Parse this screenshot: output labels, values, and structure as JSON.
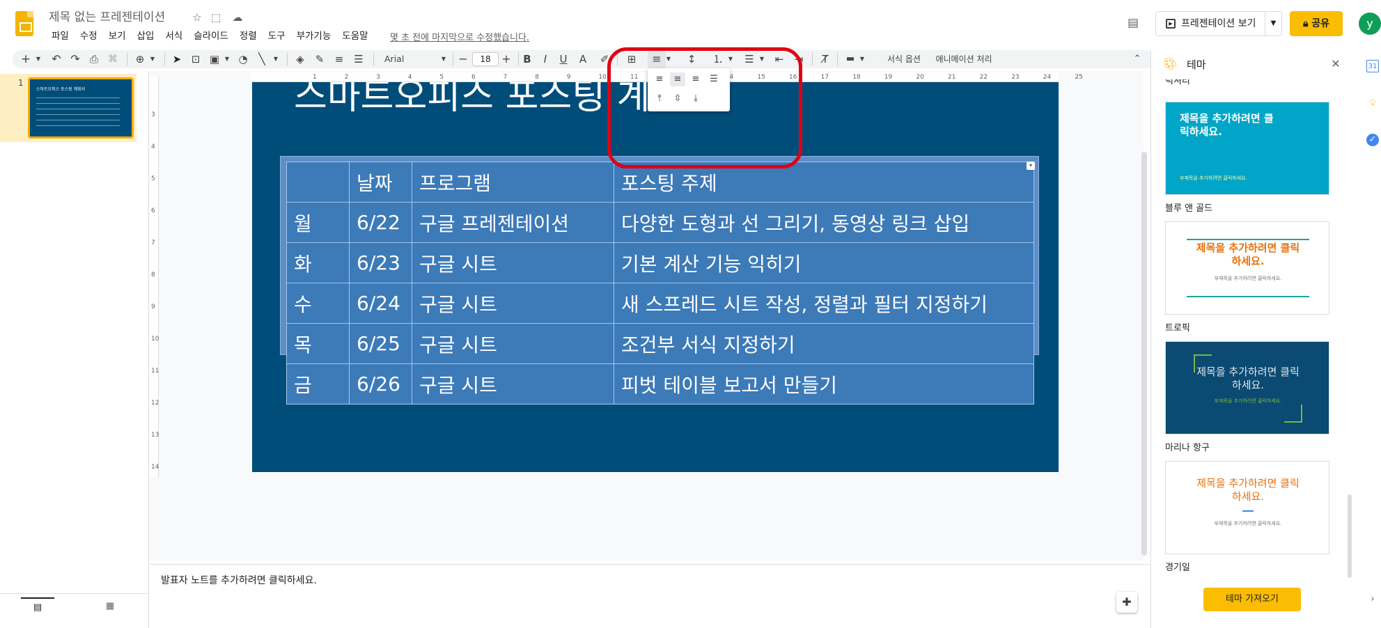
{
  "header": {
    "title": "제목 없는 프레젠테이션",
    "menu": [
      "파일",
      "수정",
      "보기",
      "삽입",
      "서식",
      "슬라이드",
      "정렬",
      "도구",
      "부가기능",
      "도움말"
    ],
    "last_edit": "몇 초 전에 마지막으로 수정했습니다.",
    "present_label": "프레젠테이션 보기",
    "share_label": "공유",
    "avatar_letter": "y"
  },
  "toolbar": {
    "font_name": "Arial",
    "font_size": "18",
    "format_options": "서식 옵션",
    "animation": "애니메이션 처리"
  },
  "filmstrip": {
    "slide_number": "1",
    "thumb_title": "스마트오피스 포스팅 계획서"
  },
  "slide": {
    "title": "스마트오피스 포스팅 계",
    "table": {
      "header": [
        "",
        "날짜",
        "프로그램",
        "포스팅 주제"
      ],
      "rows": [
        [
          "월",
          "6/22",
          "구글 프레젠테이션",
          "다양한 도형과 선 그리기, 동영상 링크 삽입"
        ],
        [
          "화",
          "6/23",
          "구글 시트",
          "기본 계산 기능 익히기"
        ],
        [
          "수",
          "6/24",
          "구글 시트",
          "새 스프레드 시트 작성, 정렬과 필터 지정하기"
        ],
        [
          "목",
          "6/25",
          "구글 시트",
          "조건부 서식 지정하기"
        ],
        [
          "금",
          "6/26",
          "구글 시트",
          "피벗 테이블 보고서 만들기"
        ]
      ]
    }
  },
  "ruler_h": [
    "1",
    "2",
    "3",
    "4",
    "5",
    "6",
    "7",
    "8",
    "9",
    "10",
    "11",
    "12",
    "13",
    "14",
    "15",
    "16",
    "17",
    "18",
    "19",
    "20",
    "21",
    "22",
    "23",
    "24",
    "25"
  ],
  "ruler_v": [
    "3",
    "4",
    "5",
    "6",
    "7",
    "8",
    "9",
    "10",
    "11",
    "12",
    "13",
    "14"
  ],
  "notes": {
    "placeholder": "발표자 노트를 추가하려면 클릭하세요."
  },
  "theme_panel": {
    "title": "테마",
    "partial_label": "럭셔리",
    "themes": [
      {
        "name": "블루 앤 골드",
        "card_title": "제목을 추가하려면 클릭하세요.",
        "card_sub": "부제목을 추가하려면 클릭하세요.",
        "bg": "#00a5c8",
        "fg": "#ffffff"
      },
      {
        "name": "트로픽",
        "card_title": "제목을 추가하려면 클릭하세요.",
        "card_sub": "부제목을 추가하려면 클릭하세요.",
        "bg": "#ffffff",
        "fg": "#e8710a"
      },
      {
        "name": "마리나 항구",
        "card_title": "제목을 추가하려면 클릭하세요.",
        "card_sub": "부제목을 추가하려면 클릭하세요.",
        "bg": "#0b4a72",
        "fg": "#dfe8ef"
      },
      {
        "name": "경기일",
        "card_title": "제목을 추가하려면 클릭하세요.",
        "card_sub": "부제목을 추가하려면 클릭하세요.",
        "bg": "#ffffff",
        "fg": "#e8710a"
      }
    ],
    "import_label": "테마 가져오기"
  },
  "colors": {
    "accent": "#fbbc04",
    "slide_bg": "#004d7a",
    "table_fill": "#3d7ab8",
    "highlight": "#e00012"
  }
}
